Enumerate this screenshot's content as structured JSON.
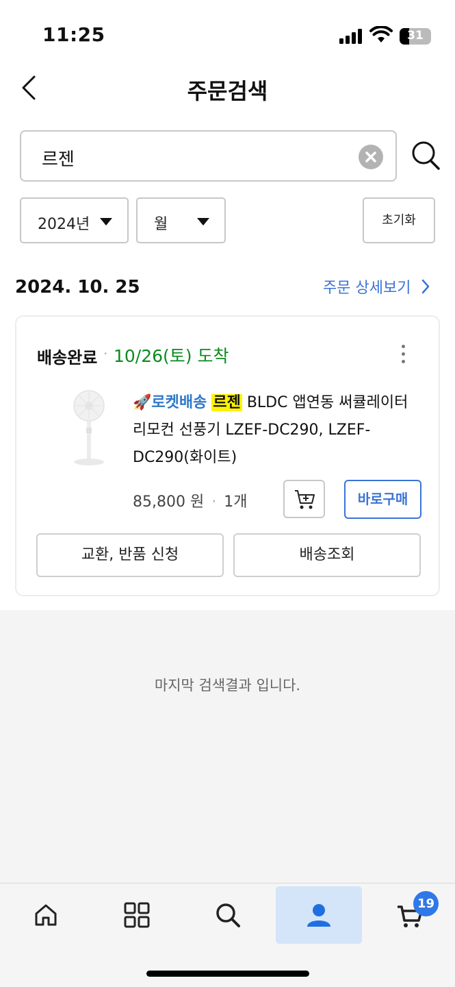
{
  "status_bar": {
    "time": "11:25",
    "battery": "31"
  },
  "header": {
    "title": "주문검색"
  },
  "search": {
    "value": "르젠"
  },
  "filters": {
    "year": "2024년",
    "month": "월",
    "reset_label": "초기화"
  },
  "order_group": {
    "date": "2024. 10. 25",
    "detail_link": "주문 상세보기"
  },
  "order": {
    "status": "배송완료",
    "separator": "·",
    "arrival": "10/26(토) 도착",
    "rocket_label": "🚀로켓배송",
    "highlight": "르젠",
    "title_rest": " BLDC 앱연동 써큘레이터 리모컨 선풍기 LZEF-DC290, LZEF-DC290(화이트)",
    "price": "85,800 원",
    "qty": "1개",
    "buy_now_label": "바로구매",
    "exchange_label": "교환, 반품 신청",
    "tracking_label": "배송조회"
  },
  "end_message": "마지막 검색결과 입니다.",
  "tab_bar": {
    "items": [
      {
        "icon": "home-icon"
      },
      {
        "icon": "grid-icon"
      },
      {
        "icon": "search-icon"
      },
      {
        "icon": "user-icon",
        "active": true
      },
      {
        "icon": "cart-icon"
      }
    ],
    "cart_badge": "19"
  },
  "colors": {
    "accent": "#3a73d6",
    "arrival": "#0a8a1f",
    "highlight": "#fff200",
    "active_tab": "#d4e5f9",
    "badge": "#2f78e8"
  }
}
